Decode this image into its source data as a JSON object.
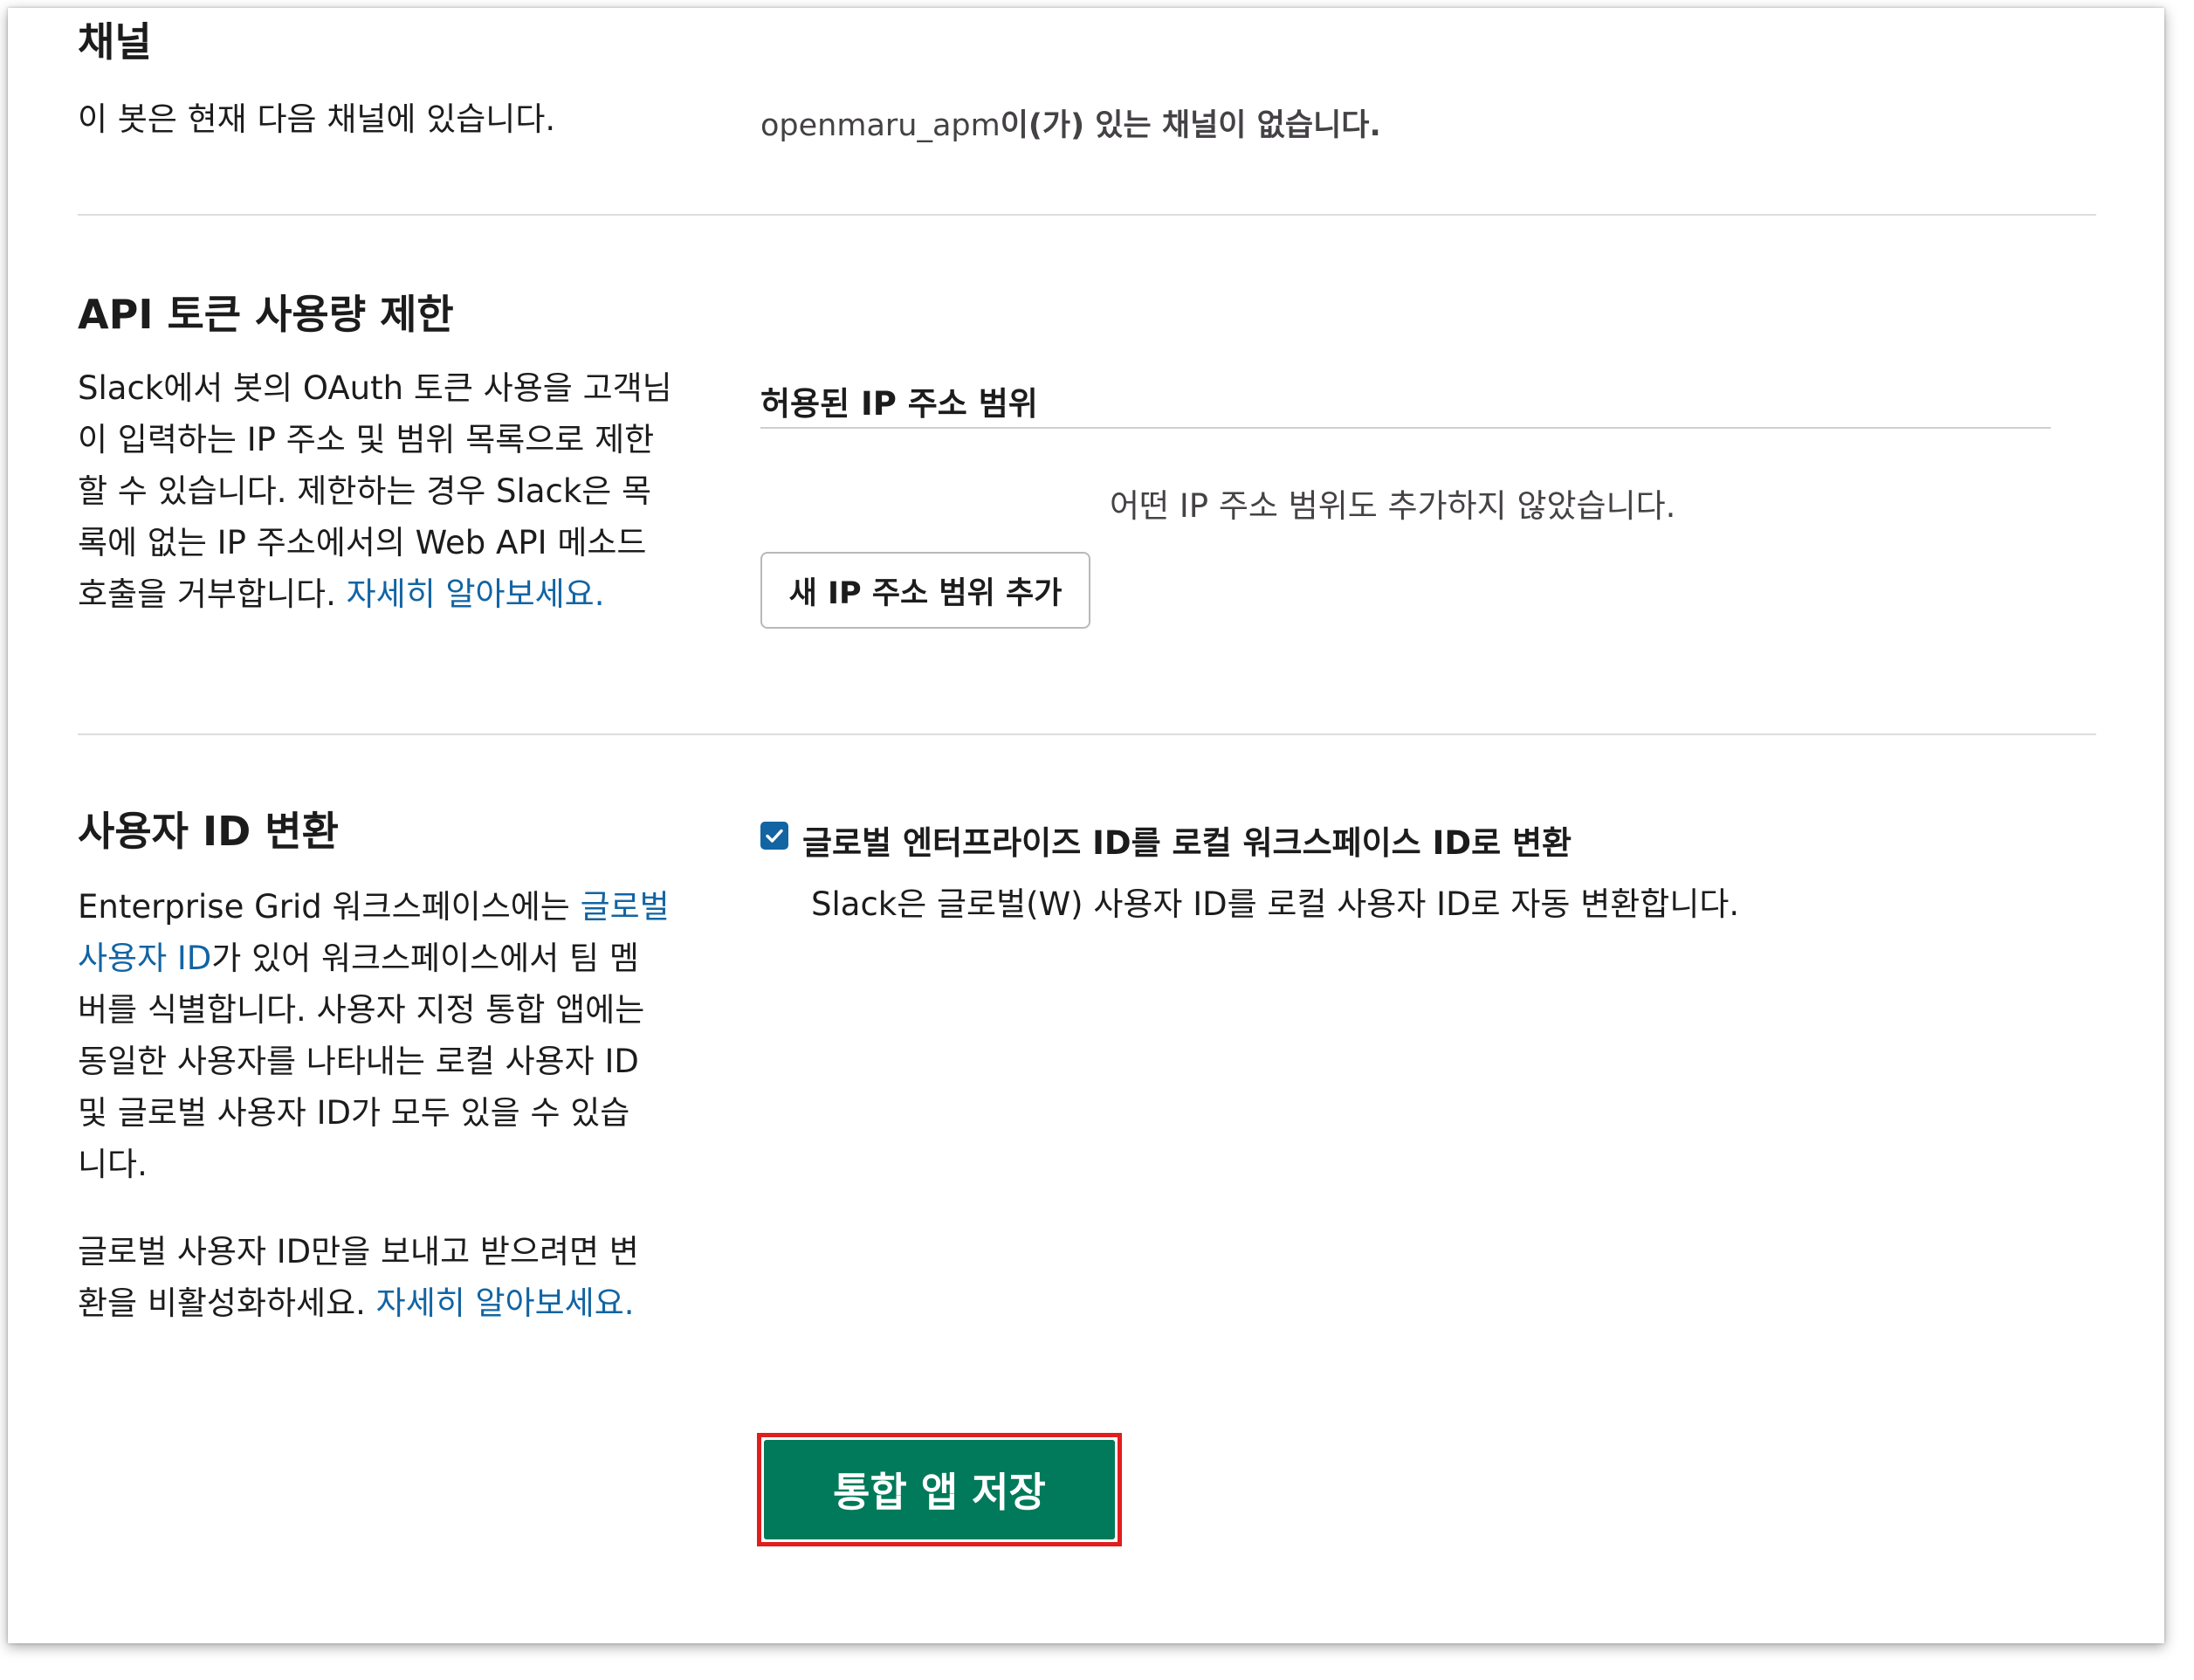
{
  "channels": {
    "title": "채널",
    "description": "이 봇은 현재 다음 채널에 있습니다.",
    "status_app": "openmaru_apm",
    "status_text": "이(가) 있는 채널이 없습니다."
  },
  "api_limit": {
    "title": "API 토큰 사용량 제한",
    "description_lines": [
      "Slack에서 봇의 OAuth 토큰 사용을 고객님",
      "이 입력하는 IP 주소 및 범위 목록으로 제한",
      "할 수 있습니다. 제한하는 경우 Slack은 목",
      "록에 없는 IP 주소에서의 Web API 메소드",
      "호출을 거부합니다."
    ],
    "learn_more": "자세히 알아보세요.",
    "allowed_ip_header": "허용된 IP 주소 범위",
    "empty_message": "어떤 IP 주소 범위도 추가하지 않았습니다.",
    "add_button": "새 IP 주소 범위 추가"
  },
  "user_id": {
    "title": "사용자 ID 변환",
    "p1_prefix": "Enterprise Grid 워크스페이스에는 ",
    "p1_link": "글로벌",
    "p1_link2": "사용자 ID",
    "p1_after_link": "가 있어 워크스페이스에서 팀 멤",
    "p1_lines": [
      "버를 식별합니다. 사용자 지정 통합 앱에는",
      "동일한 사용자를 나타내는 로컬 사용자 ID",
      "및 글로벌 사용자 ID가 모두 있을 수 있습",
      "니다."
    ],
    "p2_lines": [
      "글로벌 사용자 ID만을 보내고 받으려면 변",
      "환을 비활성화하세요."
    ],
    "learn_more": "자세히 알아보세요.",
    "checkbox_label": "글로벌 엔터프라이즈 ID를 로컬 워크스페이스 ID로 변환",
    "checkbox_checked": true,
    "checkbox_description": "Slack은 글로벌(W) 사용자 ID를 로컬 사용자 ID로 자동 변환합니다."
  },
  "save_button": "통합 앱 저장",
  "colors": {
    "link": "#1264a3",
    "save_button": "#007a5a",
    "highlight": "#e01e1e",
    "checkbox": "#1264a3"
  }
}
